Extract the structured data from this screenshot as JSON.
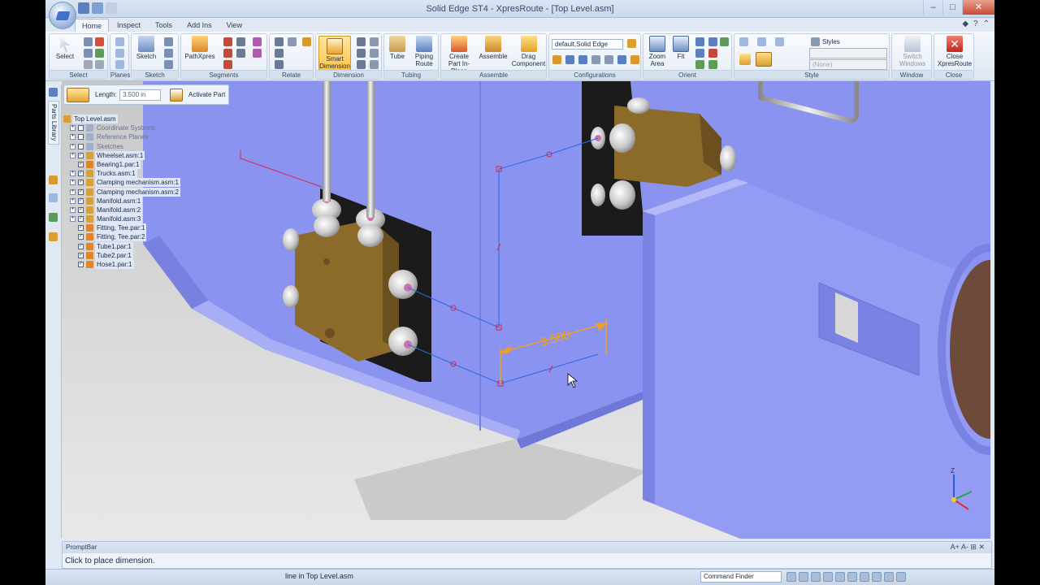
{
  "window": {
    "title": "Solid Edge ST4 - XpresRoute - [Top Level.asm]"
  },
  "window_buttons": {
    "minimize": "–",
    "maximize": "□",
    "close": "✕"
  },
  "tabs": [
    "Home",
    "Inspect",
    "Tools",
    "Add Ins",
    "View"
  ],
  "active_tab": "Home",
  "ribbon": {
    "select": {
      "label": "Select",
      "group": "Select"
    },
    "planes": {
      "group": "Planes"
    },
    "sketch": {
      "label": "Sketch",
      "group": "Sketch"
    },
    "segments": {
      "label": "PathXpres",
      "group": "Segments"
    },
    "relate": {
      "group": "Relate"
    },
    "dimension": {
      "label": "Smart Dimension",
      "group": "Dimension"
    },
    "tubing": {
      "tube": "Tube",
      "piping_route": "Piping Route",
      "group": "Tubing"
    },
    "assemble": {
      "create_part": "Create Part In-Place",
      "assemble": "Assemble",
      "drag": "Drag Component",
      "group": "Assemble"
    },
    "configurations": {
      "value": "default,Solid Edge",
      "group": "Configurations"
    },
    "orient": {
      "zoom_area": "Zoom Area",
      "fit": "Fit",
      "group": "Orient"
    },
    "style": {
      "styles_label": "Styles",
      "style_value": "(None)",
      "group": "Style"
    },
    "window": {
      "switch": "Switch Windows",
      "group": "Window"
    },
    "close": {
      "label": "Close XpresRoute",
      "group": "Close"
    }
  },
  "command_bar": {
    "length_label": "Length:",
    "length_value": "3.500 in",
    "activate_part": "Activate Part"
  },
  "side_tab": "Parts Library",
  "tree": [
    {
      "label": "Top Level.asm",
      "indent": 0,
      "expander": false,
      "checkbox": false,
      "checked": false,
      "dim": false,
      "color": "#d9a03a"
    },
    {
      "label": "Coordinate Systems",
      "indent": 1,
      "expander": true,
      "checkbox": true,
      "checked": false,
      "dim": true,
      "color": "#9fb0c8"
    },
    {
      "label": "Reference Planes",
      "indent": 1,
      "expander": true,
      "checkbox": true,
      "checked": false,
      "dim": true,
      "color": "#9fb0c8"
    },
    {
      "label": "Sketches",
      "indent": 1,
      "expander": true,
      "checkbox": true,
      "checked": false,
      "dim": true,
      "color": "#9fb0c8"
    },
    {
      "label": "Wheelset.asm:1",
      "indent": 1,
      "expander": true,
      "checkbox": true,
      "checked": true,
      "dim": false,
      "color": "#d9a03a"
    },
    {
      "label": "Bearing1.par:1",
      "indent": 1,
      "expander": false,
      "checkbox": true,
      "checked": true,
      "dim": false,
      "color": "#e0862a"
    },
    {
      "label": "Trucks.asm:1",
      "indent": 1,
      "expander": true,
      "checkbox": true,
      "checked": true,
      "dim": false,
      "color": "#d9a03a"
    },
    {
      "label": "Clamping mechanism.asm:1",
      "indent": 1,
      "expander": true,
      "checkbox": true,
      "checked": true,
      "dim": false,
      "color": "#d9a03a"
    },
    {
      "label": "Clamping mechanism.asm:2",
      "indent": 1,
      "expander": true,
      "checkbox": true,
      "checked": true,
      "dim": false,
      "color": "#d9a03a"
    },
    {
      "label": "Manifold.asm:1",
      "indent": 1,
      "expander": true,
      "checkbox": true,
      "checked": true,
      "dim": false,
      "color": "#d9a03a"
    },
    {
      "label": "Manifold.asm:2",
      "indent": 1,
      "expander": true,
      "checkbox": true,
      "checked": true,
      "dim": false,
      "color": "#d9a03a"
    },
    {
      "label": "Manifold.asm:3",
      "indent": 1,
      "expander": true,
      "checkbox": true,
      "checked": true,
      "dim": false,
      "color": "#d9a03a"
    },
    {
      "label": "Fitting, Tee.par:1",
      "indent": 1,
      "expander": false,
      "checkbox": true,
      "checked": true,
      "dim": false,
      "color": "#e0862a"
    },
    {
      "label": "Fitting, Tee.par:2",
      "indent": 1,
      "expander": false,
      "checkbox": true,
      "checked": true,
      "dim": false,
      "color": "#e0862a"
    },
    {
      "label": "Tube1.par:1",
      "indent": 1,
      "expander": false,
      "checkbox": true,
      "checked": true,
      "dim": false,
      "color": "#e0862a"
    },
    {
      "label": "Tube2.par:1",
      "indent": 1,
      "expander": false,
      "checkbox": true,
      "checked": true,
      "dim": false,
      "color": "#e0862a"
    },
    {
      "label": "Hose1.par:1",
      "indent": 1,
      "expander": false,
      "checkbox": true,
      "checked": true,
      "dim": false,
      "color": "#e0862a"
    }
  ],
  "viewport": {
    "dimension_value": "3.500",
    "axis_label": "Z"
  },
  "prompt_bar": {
    "title": "PromptBar",
    "text": "Click to place dimension.",
    "controls": "A+ A- ⊞ ✕"
  },
  "status_bar": {
    "text": "line in Top Level.asm",
    "command_finder": "Command Finder"
  },
  "colors": {
    "accent": "#ffc44a",
    "body_blue": "#8b93f0",
    "manifold": "#8c6a2a",
    "dimension": "#f0a020"
  }
}
